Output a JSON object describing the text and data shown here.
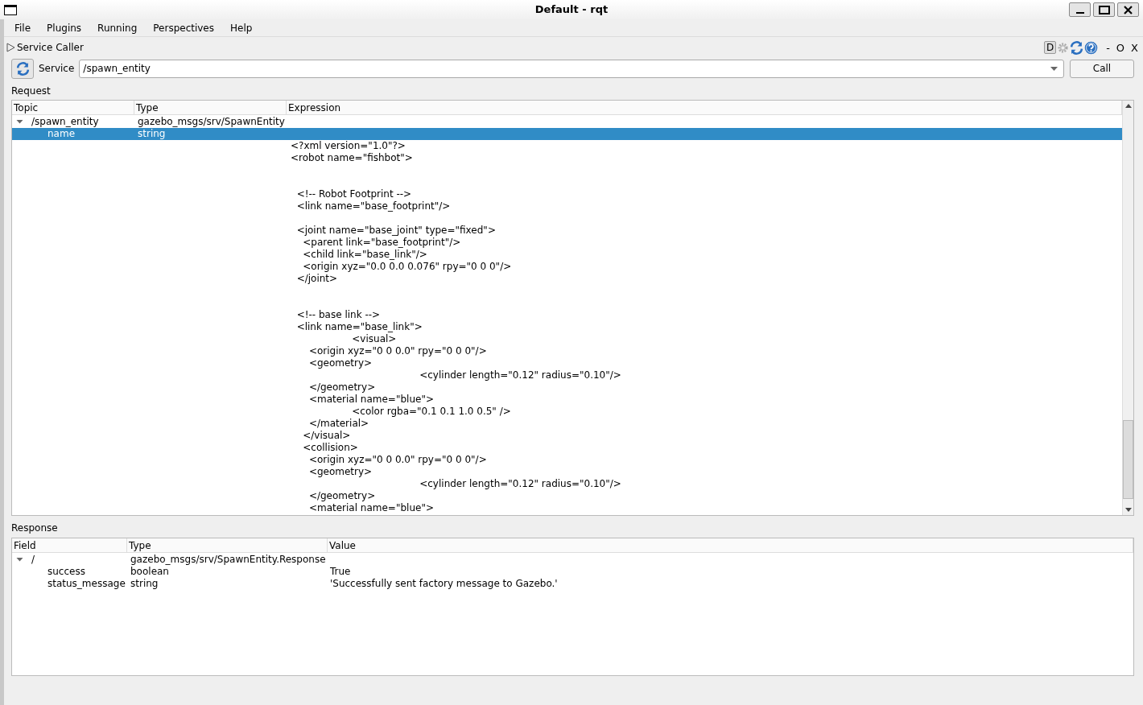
{
  "window": {
    "title": "Default - rqt"
  },
  "menu": [
    {
      "label": "File"
    },
    {
      "label": "Plugins"
    },
    {
      "label": "Running"
    },
    {
      "label": "Perspectives"
    },
    {
      "label": "Help"
    }
  ],
  "plugin": {
    "title": "Service Caller",
    "expanded": false,
    "controls": [
      "-",
      "O",
      "X"
    ],
    "debug_label": "D"
  },
  "service": {
    "label": "Service",
    "value": "/spawn_entity",
    "call_button": "Call"
  },
  "request": {
    "label": "Request",
    "columns": [
      "Topic",
      "Type",
      "Expression"
    ],
    "rows": [
      {
        "topic": "/spawn_entity",
        "type": "gazebo_msgs/srv/SpawnEntity",
        "expanded": true,
        "selected": false,
        "children": [
          {
            "topic": "name",
            "type": "string",
            "selected": true,
            "expression": "<?xml version=\"1.0\"?>\n<robot name=\"fishbot\">\n\n\n  <!-- Robot Footprint -->\n  <link name=\"base_footprint\"/>\n\n  <joint name=\"base_joint\" type=\"fixed\">\n    <parent link=\"base_footprint\"/>\n    <child link=\"base_link\"/>\n    <origin xyz=\"0.0 0.0 0.076\" rpy=\"0 0 0\"/>\n  </joint>\n\n\n  <!-- base link -->\n  <link name=\"base_link\">\n                    <visual>\n      <origin xyz=\"0 0 0.0\" rpy=\"0 0 0\"/>\n      <geometry>\n                                          <cylinder length=\"0.12\" radius=\"0.10\"/>\n      </geometry>\n      <material name=\"blue\">\n                    <color rgba=\"0.1 0.1 1.0 0.5\" />\n      </material>\n    </visual>\n    <collision>\n      <origin xyz=\"0 0 0.0\" rpy=\"0 0 0\"/>\n      <geometry>\n                                          <cylinder length=\"0.12\" radius=\"0.10\"/>\n      </geometry>\n      <material name=\"blue\">"
          }
        ]
      }
    ]
  },
  "response": {
    "label": "Response",
    "columns": [
      "Field",
      "Type",
      "Value"
    ],
    "rows": [
      {
        "field": "/",
        "type": "gazebo_msgs/srv/SpawnEntity.Response",
        "expanded": true,
        "children": [
          {
            "field": "success",
            "type": "boolean",
            "value": "True"
          },
          {
            "field": "status_message",
            "type": "string",
            "value": "'Successfully sent factory message to Gazebo.'"
          }
        ]
      }
    ]
  }
}
